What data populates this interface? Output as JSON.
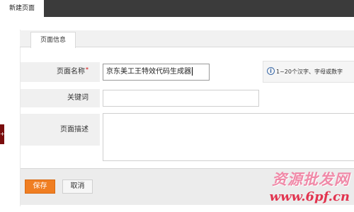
{
  "tabs": {
    "active": "新建页面"
  },
  "panel": {
    "tab_label": "页面信息"
  },
  "form": {
    "name_label": "页面名称",
    "required_mark": "*",
    "name_value": "京东美工王特效代码生成器",
    "name_hint": "1~20个汉字、字母或数字",
    "keywords_label": "关键词",
    "keywords_value": "",
    "description_label": "页面描述",
    "description_value": ""
  },
  "actions": {
    "save": "保存",
    "cancel": "取消"
  },
  "left_tab": {
    "glyph": "+"
  },
  "watermark": {
    "line1": "资源批发网",
    "line2": "www.6pf.cn"
  },
  "icons": {
    "hint": "info-circle-icon"
  },
  "colors": {
    "accent": "#f07e22",
    "topbar": "#3b3b3b",
    "watermark_pink": "#f08aa8",
    "watermark_red": "#e2344f"
  }
}
